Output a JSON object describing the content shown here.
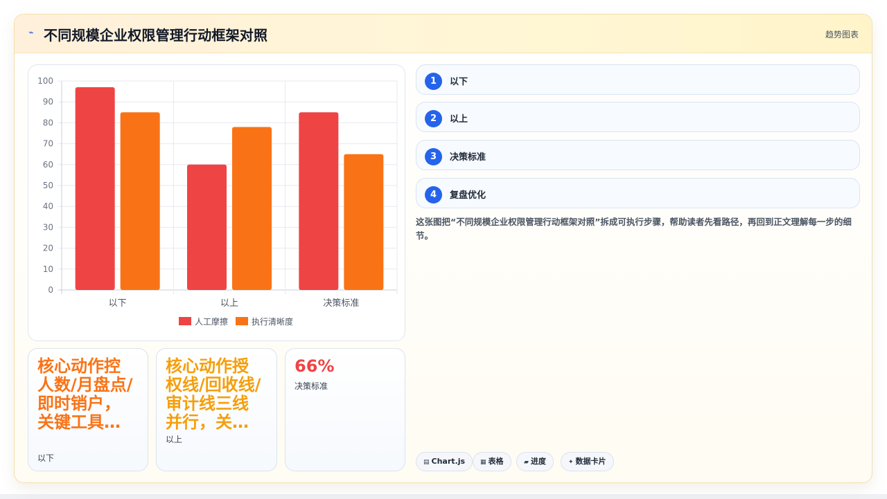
{
  "header": {
    "icon": "trend-icon",
    "title": "不同规模企业权限管理行动框架对照",
    "tag": "趋势图表"
  },
  "chart_data": {
    "type": "bar",
    "categories": [
      "以下",
      "以上",
      "决策标准"
    ],
    "series": [
      {
        "name": "人工摩擦",
        "values": [
          97,
          60,
          85
        ],
        "color": "#ef4444"
      },
      {
        "name": "执行清晰度",
        "values": [
          85,
          78,
          65
        ],
        "color": "#f97316"
      }
    ],
    "ylim": [
      0,
      100
    ],
    "yticks": [
      0,
      10,
      20,
      30,
      40,
      50,
      60,
      70,
      80,
      90,
      100
    ],
    "grid": true,
    "legend": "bottom"
  },
  "stats": [
    {
      "value": "核心动作控人数/月盘点/即时销户，关键工具…",
      "label": "以下",
      "color": "#f97316"
    },
    {
      "value": "核心动作授权线/回收线/审计线三线并行，关…",
      "label": "以上",
      "color": "#f59e0b"
    },
    {
      "value": "66%",
      "label": "决策标准",
      "color": "#ef4444"
    }
  ],
  "steps": [
    {
      "num": "1",
      "label": "以下"
    },
    {
      "num": "2",
      "label": "以上"
    },
    {
      "num": "3",
      "label": "决策标准"
    },
    {
      "num": "4",
      "label": "复盘优化"
    }
  ],
  "description": "这张图把“不同规模企业权限管理行动框架对照”拆成可执行步骤，帮助读者先看路径，再回到正文理解每一步的细节。",
  "chips": [
    {
      "icon": "chart-icon",
      "glyph": "▤",
      "label": "Chart.js"
    },
    {
      "icon": "table-icon",
      "glyph": "▦",
      "label": "表格"
    },
    {
      "icon": "progress-icon",
      "glyph": "▰",
      "label": "进度"
    },
    {
      "icon": "sparkle-icon",
      "glyph": "✦",
      "label": "数据卡片"
    }
  ]
}
